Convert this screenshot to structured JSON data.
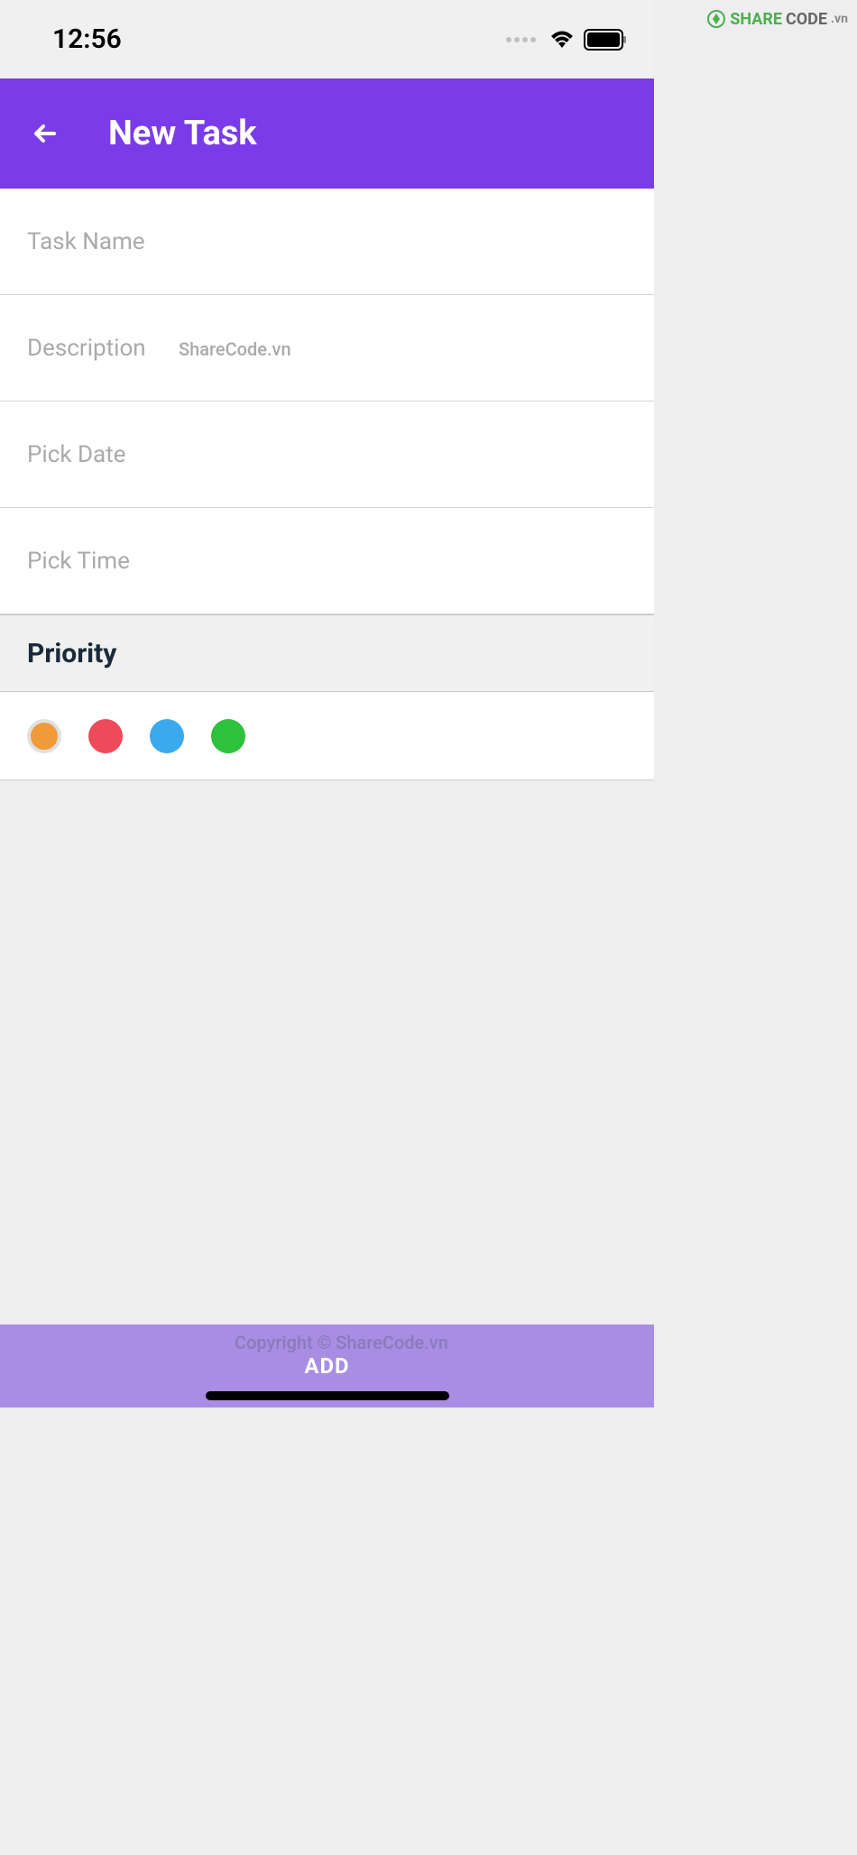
{
  "status": {
    "time": "12:56"
  },
  "header": {
    "title": "New Task"
  },
  "fields": {
    "task_name": {
      "placeholder": "Task Name",
      "value": ""
    },
    "description": {
      "placeholder": "Description",
      "value": ""
    },
    "pick_date": {
      "placeholder": "Pick Date",
      "value": ""
    },
    "pick_time": {
      "placeholder": "Pick Time",
      "value": ""
    }
  },
  "priority": {
    "label": "Priority",
    "options": [
      {
        "color": "#f09a3a",
        "selected": true
      },
      {
        "color": "#ed4a5a",
        "selected": false
      },
      {
        "color": "#3aa9ed",
        "selected": false
      },
      {
        "color": "#2ec13c",
        "selected": false
      }
    ]
  },
  "button": {
    "add_label": "ADD"
  },
  "watermarks": {
    "top_share": "SHARE",
    "top_code": "CODE",
    "top_vn": ".vn",
    "center": "ShareCode.vn",
    "copyright": "Copyright © ShareCode.vn"
  }
}
